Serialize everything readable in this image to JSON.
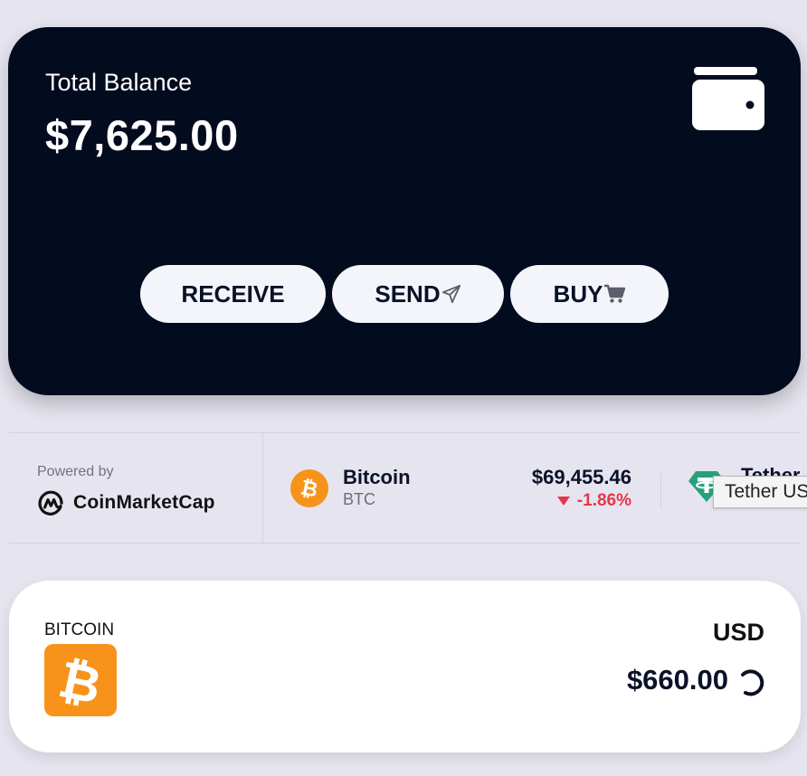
{
  "balance": {
    "label": "Total Balance",
    "value": "$7,625.00",
    "icon": "wallet-icon"
  },
  "actions": {
    "receive_label": "RECEIVE",
    "send_label": "SEND",
    "send_icon": "paper-plane-icon",
    "buy_label": "BUY",
    "buy_icon": "cart-icon"
  },
  "ticker": {
    "powered_by": "Powered by",
    "brand_name": "CoinMarketCap",
    "coins": [
      {
        "name": "Bitcoin",
        "symbol": "BTC",
        "price": "$69,455.46",
        "change": "-1.86%",
        "icon": "bitcoin-icon"
      },
      {
        "name": "Tether",
        "icon": "tether-icon"
      }
    ],
    "tooltip": "Tether US"
  },
  "asset": {
    "label": "BITCOIN",
    "currency": "USD",
    "value": "$660.00",
    "icon": "bitcoin-icon"
  },
  "colors": {
    "card_dark": "#030b1f",
    "background": "#e6e5ef",
    "negative": "#e5364a",
    "bitcoin_orange": "#f7931a",
    "tether_green": "#26a17b"
  }
}
